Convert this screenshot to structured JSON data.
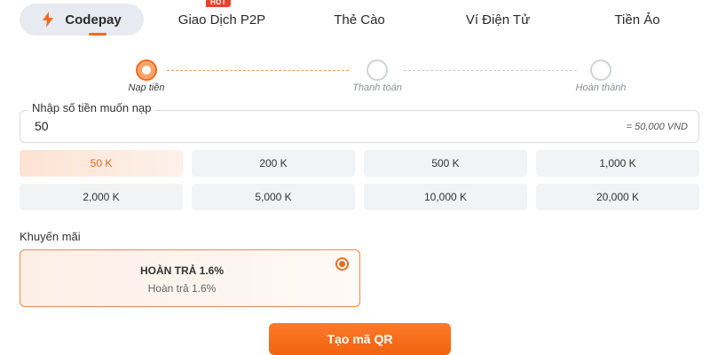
{
  "tabs": [
    {
      "label": "Codepay",
      "icon": "lightning-bolt-icon",
      "active": true
    },
    {
      "label": "Giao Dịch P2P",
      "badge": "HOT"
    },
    {
      "label": "Thẻ Cào"
    },
    {
      "label": "Ví Điện Tử"
    },
    {
      "label": "Tiền Ảo"
    }
  ],
  "stepper": {
    "steps": [
      {
        "label": "Nạp tiền",
        "active": true
      },
      {
        "label": "Thanh toán",
        "active": false
      },
      {
        "label": "Hoàn thành",
        "active": false
      }
    ]
  },
  "amount": {
    "label": "Nhập số tiền muốn nạp",
    "value": "50",
    "converted": "= 50,000 VND"
  },
  "presets": [
    {
      "label": "50 K",
      "selected": true
    },
    {
      "label": "200 K"
    },
    {
      "label": "500 K"
    },
    {
      "label": "1,000 K"
    },
    {
      "label": "2,000 K"
    },
    {
      "label": "5,000 K"
    },
    {
      "label": "10,000 K"
    },
    {
      "label": "20,000 K"
    }
  ],
  "promotion": {
    "heading": "Khuyến mãi",
    "title": "HOÀN TRẢ 1.6%",
    "subtitle": "Hoàn trả 1.6%",
    "selected": true
  },
  "submit_label": "Tạo mã QR",
  "colors": {
    "accent": "#f26b1d",
    "tab_active_bg": "#e7eaf0",
    "preset_bg": "#f2f3f5",
    "hot_badge": "#e8412c"
  }
}
